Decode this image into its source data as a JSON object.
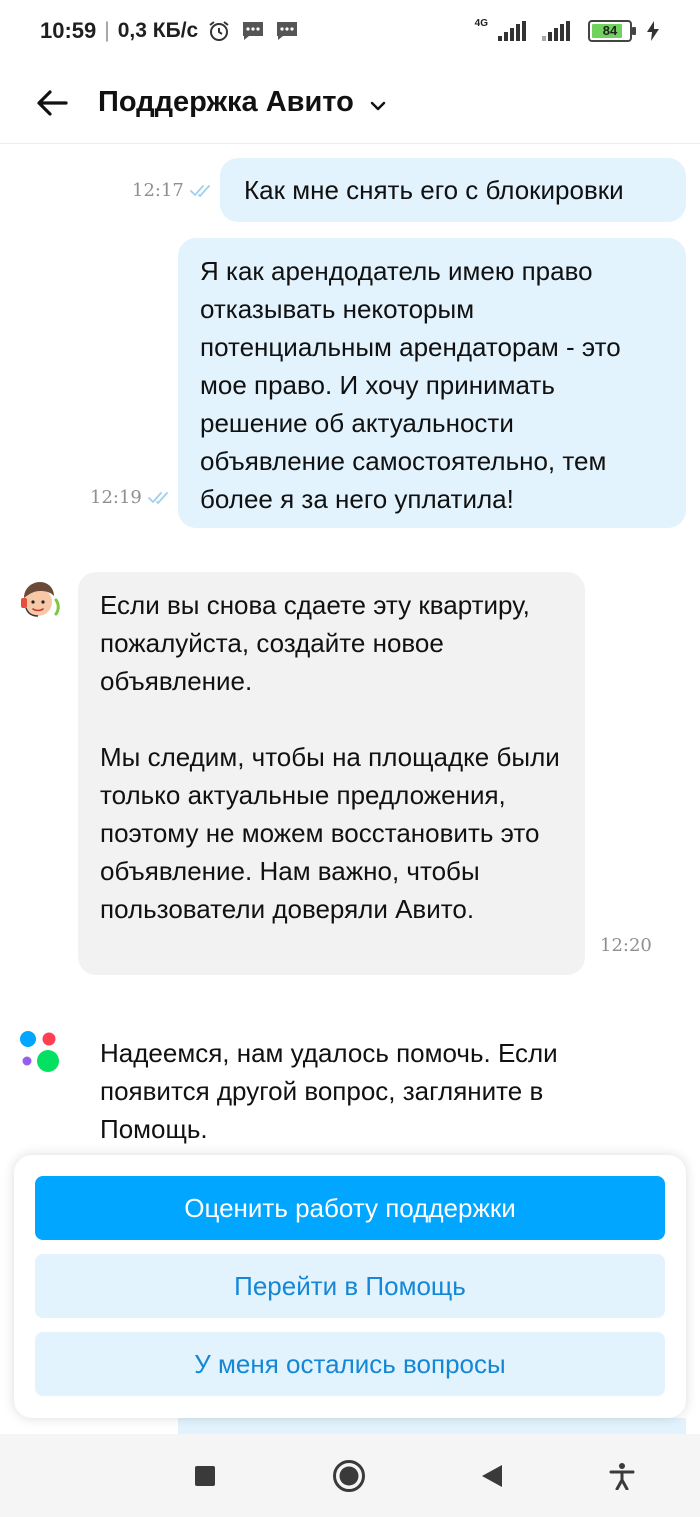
{
  "status_bar": {
    "time": "10:59",
    "speed": "0,3 КБ/с",
    "network_label": "4G",
    "battery_level": "84",
    "icons": [
      "alarm-icon",
      "message-icon",
      "message-icon",
      "signal-icon",
      "battery-icon",
      "charging-icon"
    ]
  },
  "header": {
    "title": "Поддержка Авито",
    "back_icon": "arrow-left-icon",
    "chevron_icon": "chevron-down-icon"
  },
  "messages": [
    {
      "direction": "out",
      "time": "12:17",
      "read": true,
      "text": "Как мне снять его с блокировки"
    },
    {
      "direction": "out",
      "time": "12:19",
      "read": true,
      "text": "Я как арендодатель имею право отказывать некоторым потенциальным арендаторам - это мое право. И хочу принимать решение об актуальности объявление самостоятельно, тем более я за него уплатила!"
    },
    {
      "direction": "in",
      "time": "12:20",
      "paragraphs": [
        "Если вы снова сдаете эту квартиру, пожалуйста, создайте новое объявление.",
        "Мы следим, чтобы на площадке были только актуальные предложения, поэтому не можем восстановить это объявление. Нам важно, чтобы пользователи доверяли Авито."
      ]
    },
    {
      "direction": "system",
      "text": "Надеемся, нам удалось помочь. Если появится другой вопрос, загляните в Помощь."
    }
  ],
  "actions": {
    "rate_label": "Оценить работу поддержки",
    "help_label": "Перейти в Помощь",
    "questions_label": "У меня остались вопросы"
  },
  "colors": {
    "primary": "#00a6ff",
    "secondary_bg": "#e2f3fd",
    "secondary_text": "#1487d6",
    "incoming_bg": "#f2f2f2",
    "read_check": "#9fd0ee"
  },
  "nav": {
    "icons": [
      "recent-apps-icon",
      "home-icon",
      "back-icon",
      "accessibility-icon"
    ]
  }
}
